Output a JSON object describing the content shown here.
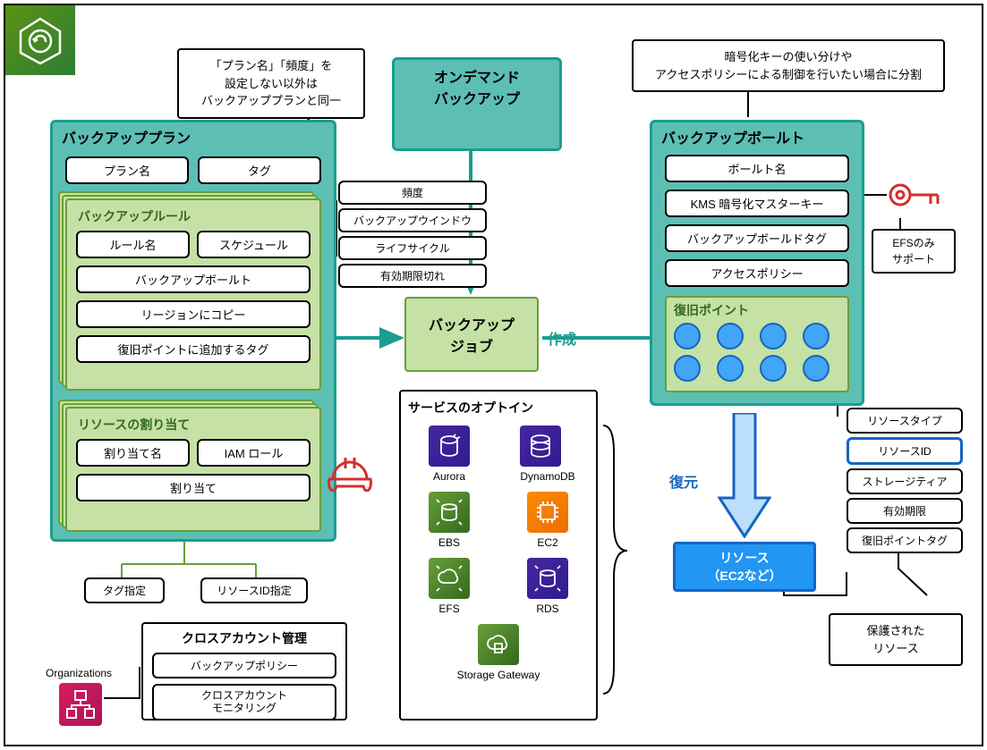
{
  "callouts": {
    "plan_note": "「プラン名」「頻度」を\n設定しない以外は\nバックアッププランと同一",
    "vault_note": "暗号化キーの使い分けや\nアクセスポリシーによる制御を行いたい場合に分割",
    "efs_note": "EFSのみ\nサポート",
    "protected": "保護された\nリソース"
  },
  "ondemand": {
    "title": "オンデマンド\nバックアップ"
  },
  "plan": {
    "title": "バックアッププラン",
    "plan_name": "プラン名",
    "tag": "タグ",
    "rule": {
      "title": "バックアップルール",
      "name": "ルール名",
      "schedule": "スケジュール",
      "vault": "バックアップボールト",
      "region": "リージョンにコピー",
      "tag": "復旧ポイントに追加するタグ"
    },
    "side": {
      "freq": "頻度",
      "window": "バックアップウインドウ",
      "lifecycle": "ライフサイクル",
      "expire": "有効期限切れ"
    },
    "assign": {
      "title": "リソースの割り当て",
      "name": "割り当て名",
      "iam": "IAM ロール",
      "assign": "割り当て"
    },
    "tag_spec": "タグ指定",
    "id_spec": "リソースID指定"
  },
  "job": {
    "title": "バックアップ\nジョブ",
    "create": "作成"
  },
  "vault": {
    "title": "バックアップボールト",
    "name": "ボールト名",
    "kms": "KMS 暗号化マスターキー",
    "tag": "バックアップボールドタグ",
    "policy": "アクセスポリシー",
    "recovery": {
      "title": "復旧ポイント"
    }
  },
  "restore": "復元",
  "resource": "リソース\n（EC2など）",
  "attrs": {
    "type": "リソースタイプ",
    "id": "リソースID",
    "tier": "ストレージティア",
    "expire": "有効期限",
    "tag": "復旧ポイントタグ"
  },
  "cross": {
    "title": "クロスアカウント管理",
    "policy": "バックアップポリシー",
    "monitor": "クロスアカウント\nモニタリング",
    "org": "Organizations"
  },
  "optin": {
    "title": "サービスのオプトイン",
    "aurora": "Aurora",
    "dynamo": "DynamoDB",
    "ebs": "EBS",
    "ec2": "EC2",
    "efs": "EFS",
    "rds": "RDS",
    "gw": "Storage Gateway"
  }
}
